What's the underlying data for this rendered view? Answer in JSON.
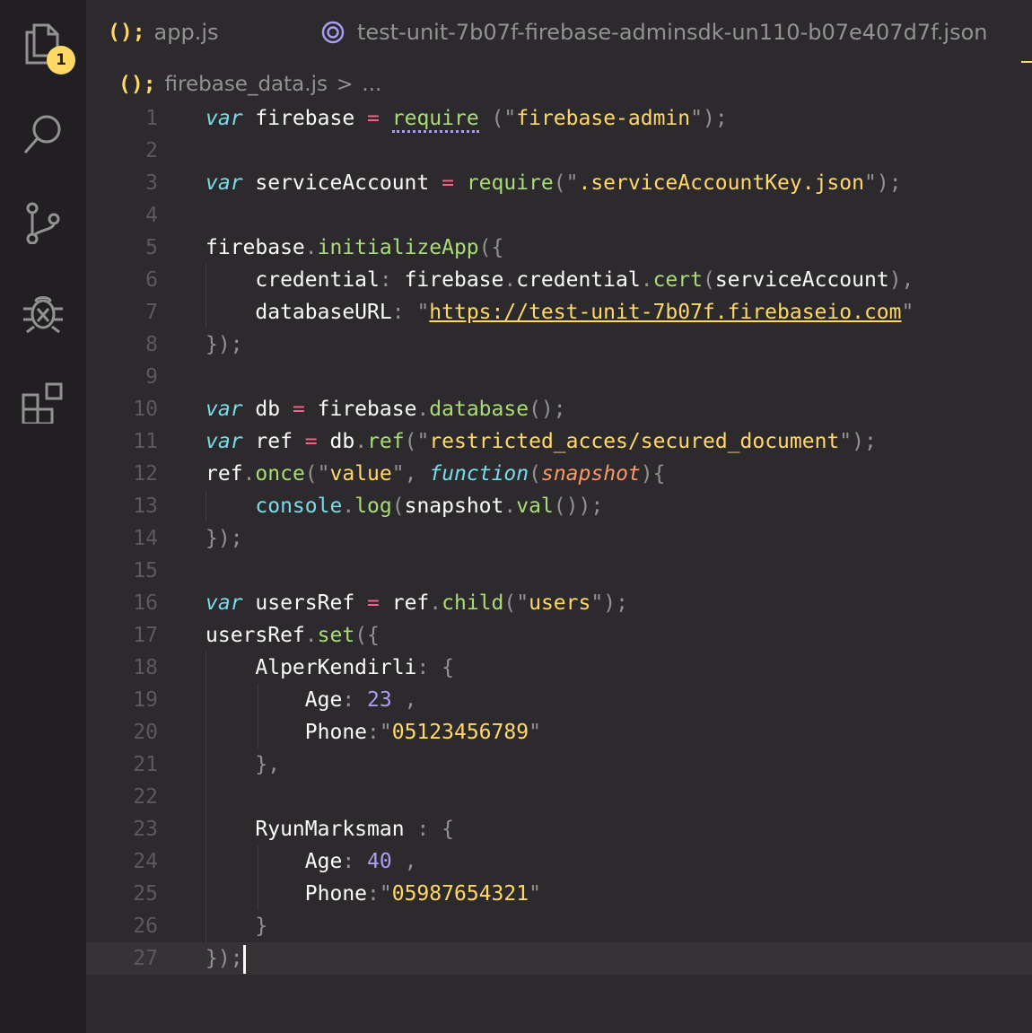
{
  "activity_bar": {
    "explorer_badge": "1",
    "icons": [
      "files-icon",
      "search-icon",
      "source-control-icon",
      "debug-icon",
      "extensions-icon"
    ]
  },
  "tabs": [
    {
      "icon": "js-icon",
      "icon_text": "();",
      "label": "app.js"
    },
    {
      "icon": "firebase-json-icon",
      "label": "test-unit-7b07f-firebase-adminsdk-un110-b07e407d7f.json"
    }
  ],
  "breadcrumb": {
    "icon_text": "();",
    "file": "firebase_data.js",
    "separator": ">",
    "more": "..."
  },
  "theme": {
    "keyword": "#78dce8",
    "operator": "#ff6188",
    "function": "#a9dc76",
    "string": "#ffd866",
    "number": "#ab9df2",
    "parameter": "#fc9867",
    "punctuation": "#939293",
    "text": "#fcfcfa",
    "line_number": "#5b595c",
    "editor_bg": "#2d2a2e",
    "activity_bg": "#221f22"
  },
  "editor": {
    "current_line": 27,
    "lines": [
      {
        "n": "1",
        "indent": 0,
        "tokens": [
          [
            "kw",
            "var"
          ],
          [
            "t",
            " firebase "
          ],
          [
            "op",
            "="
          ],
          [
            "t",
            " "
          ],
          [
            "fn-dot",
            "require"
          ],
          [
            "t",
            " "
          ],
          [
            "pun",
            "("
          ],
          [
            "str-q",
            "\""
          ],
          [
            "str",
            "firebase-admin"
          ],
          [
            "str-q",
            "\""
          ],
          [
            "pun",
            ");"
          ]
        ]
      },
      {
        "n": "2",
        "indent": 0,
        "tokens": []
      },
      {
        "n": "3",
        "indent": 0,
        "tokens": [
          [
            "kw",
            "var"
          ],
          [
            "t",
            " serviceAccount "
          ],
          [
            "op",
            "="
          ],
          [
            "t",
            " "
          ],
          [
            "fn",
            "require"
          ],
          [
            "pun",
            "("
          ],
          [
            "str-q",
            "\""
          ],
          [
            "str",
            ".serviceAccountKey.json"
          ],
          [
            "str-q",
            "\""
          ],
          [
            "pun",
            ");"
          ]
        ]
      },
      {
        "n": "4",
        "indent": 0,
        "tokens": []
      },
      {
        "n": "5",
        "indent": 0,
        "tokens": [
          [
            "t",
            "firebase"
          ],
          [
            "pun",
            "."
          ],
          [
            "fn",
            "initializeApp"
          ],
          [
            "pun",
            "({"
          ]
        ]
      },
      {
        "n": "6",
        "indent": 1,
        "tokens": [
          [
            "t",
            "    credential"
          ],
          [
            "pun",
            ":"
          ],
          [
            "t",
            " firebase"
          ],
          [
            "pun",
            "."
          ],
          [
            "t",
            "credential"
          ],
          [
            "pun",
            "."
          ],
          [
            "fn",
            "cert"
          ],
          [
            "pun",
            "("
          ],
          [
            "t",
            "serviceAccount"
          ],
          [
            "pun",
            "),"
          ]
        ]
      },
      {
        "n": "7",
        "indent": 1,
        "tokens": [
          [
            "t",
            "    databaseURL"
          ],
          [
            "pun",
            ":"
          ],
          [
            "t",
            " "
          ],
          [
            "str-q",
            "\""
          ],
          [
            "link",
            "https://test-unit-7b07f.firebaseio.com"
          ],
          [
            "str-q",
            "\""
          ]
        ]
      },
      {
        "n": "8",
        "indent": 0,
        "tokens": [
          [
            "pun",
            "});"
          ]
        ]
      },
      {
        "n": "9",
        "indent": 0,
        "tokens": []
      },
      {
        "n": "10",
        "indent": 0,
        "tokens": [
          [
            "kw",
            "var"
          ],
          [
            "t",
            " db "
          ],
          [
            "op",
            "="
          ],
          [
            "t",
            " firebase"
          ],
          [
            "pun",
            "."
          ],
          [
            "fn",
            "database"
          ],
          [
            "pun",
            "();"
          ]
        ]
      },
      {
        "n": "11",
        "indent": 0,
        "tokens": [
          [
            "kw",
            "var"
          ],
          [
            "t",
            " ref "
          ],
          [
            "op",
            "="
          ],
          [
            "t",
            " db"
          ],
          [
            "pun",
            "."
          ],
          [
            "fn",
            "ref"
          ],
          [
            "pun",
            "("
          ],
          [
            "str-q",
            "\""
          ],
          [
            "str",
            "restricted_acces/secured_document"
          ],
          [
            "str-q",
            "\""
          ],
          [
            "pun",
            ");"
          ]
        ]
      },
      {
        "n": "12",
        "indent": 0,
        "tokens": [
          [
            "t",
            "ref"
          ],
          [
            "pun",
            "."
          ],
          [
            "fn",
            "once"
          ],
          [
            "pun",
            "("
          ],
          [
            "str-q",
            "\""
          ],
          [
            "str",
            "value"
          ],
          [
            "str-q",
            "\""
          ],
          [
            "pun",
            ","
          ],
          [
            "t",
            " "
          ],
          [
            "kw",
            "function"
          ],
          [
            "pun",
            "("
          ],
          [
            "param",
            "snapshot"
          ],
          [
            "pun",
            "){"
          ]
        ]
      },
      {
        "n": "13",
        "indent": 1,
        "tokens": [
          [
            "t",
            "    "
          ],
          [
            "kw-n",
            "console"
          ],
          [
            "pun",
            "."
          ],
          [
            "fn",
            "log"
          ],
          [
            "pun",
            "("
          ],
          [
            "t",
            "snapshot"
          ],
          [
            "pun",
            "."
          ],
          [
            "fn",
            "val"
          ],
          [
            "pun",
            "());"
          ]
        ]
      },
      {
        "n": "14",
        "indent": 0,
        "tokens": [
          [
            "pun",
            "});"
          ]
        ]
      },
      {
        "n": "15",
        "indent": 0,
        "tokens": []
      },
      {
        "n": "16",
        "indent": 0,
        "tokens": [
          [
            "kw",
            "var"
          ],
          [
            "t",
            " usersRef "
          ],
          [
            "op",
            "="
          ],
          [
            "t",
            " ref"
          ],
          [
            "pun",
            "."
          ],
          [
            "fn",
            "child"
          ],
          [
            "pun",
            "("
          ],
          [
            "str-q",
            "\""
          ],
          [
            "str",
            "users"
          ],
          [
            "str-q",
            "\""
          ],
          [
            "pun",
            ");"
          ]
        ]
      },
      {
        "n": "17",
        "indent": 0,
        "tokens": [
          [
            "t",
            "usersRef"
          ],
          [
            "pun",
            "."
          ],
          [
            "fn",
            "set"
          ],
          [
            "pun",
            "({"
          ]
        ]
      },
      {
        "n": "18",
        "indent": 1,
        "tokens": [
          [
            "t",
            "    AlperKendirli"
          ],
          [
            "pun",
            ":"
          ],
          [
            "t",
            " "
          ],
          [
            "pun",
            "{"
          ]
        ]
      },
      {
        "n": "19",
        "indent": 2,
        "tokens": [
          [
            "t",
            "        Age"
          ],
          [
            "pun",
            ":"
          ],
          [
            "t",
            " "
          ],
          [
            "num",
            "23"
          ],
          [
            "t",
            " "
          ],
          [
            "pun",
            ","
          ]
        ]
      },
      {
        "n": "20",
        "indent": 2,
        "tokens": [
          [
            "t",
            "        Phone"
          ],
          [
            "pun",
            ":"
          ],
          [
            "str-q",
            "\""
          ],
          [
            "str",
            "05123456789"
          ],
          [
            "str-q",
            "\""
          ]
        ]
      },
      {
        "n": "21",
        "indent": 1,
        "tokens": [
          [
            "t",
            "    "
          ],
          [
            "pun",
            "},"
          ]
        ]
      },
      {
        "n": "22",
        "indent": 1,
        "tokens": []
      },
      {
        "n": "23",
        "indent": 1,
        "tokens": [
          [
            "t",
            "    RyunMarksman "
          ],
          [
            "pun",
            ":"
          ],
          [
            "t",
            " "
          ],
          [
            "pun",
            "{"
          ]
        ]
      },
      {
        "n": "24",
        "indent": 2,
        "tokens": [
          [
            "t",
            "        Age"
          ],
          [
            "pun",
            ":"
          ],
          [
            "t",
            " "
          ],
          [
            "num",
            "40"
          ],
          [
            "t",
            " "
          ],
          [
            "pun",
            ","
          ]
        ]
      },
      {
        "n": "25",
        "indent": 2,
        "tokens": [
          [
            "t",
            "        Phone"
          ],
          [
            "pun",
            ":"
          ],
          [
            "str-q",
            "\""
          ],
          [
            "str",
            "05987654321"
          ],
          [
            "str-q",
            "\""
          ]
        ]
      },
      {
        "n": "26",
        "indent": 1,
        "tokens": [
          [
            "t",
            "    "
          ],
          [
            "pun",
            "}"
          ]
        ]
      },
      {
        "n": "27",
        "indent": 0,
        "tokens": [
          [
            "pun",
            "});"
          ]
        ]
      }
    ]
  }
}
